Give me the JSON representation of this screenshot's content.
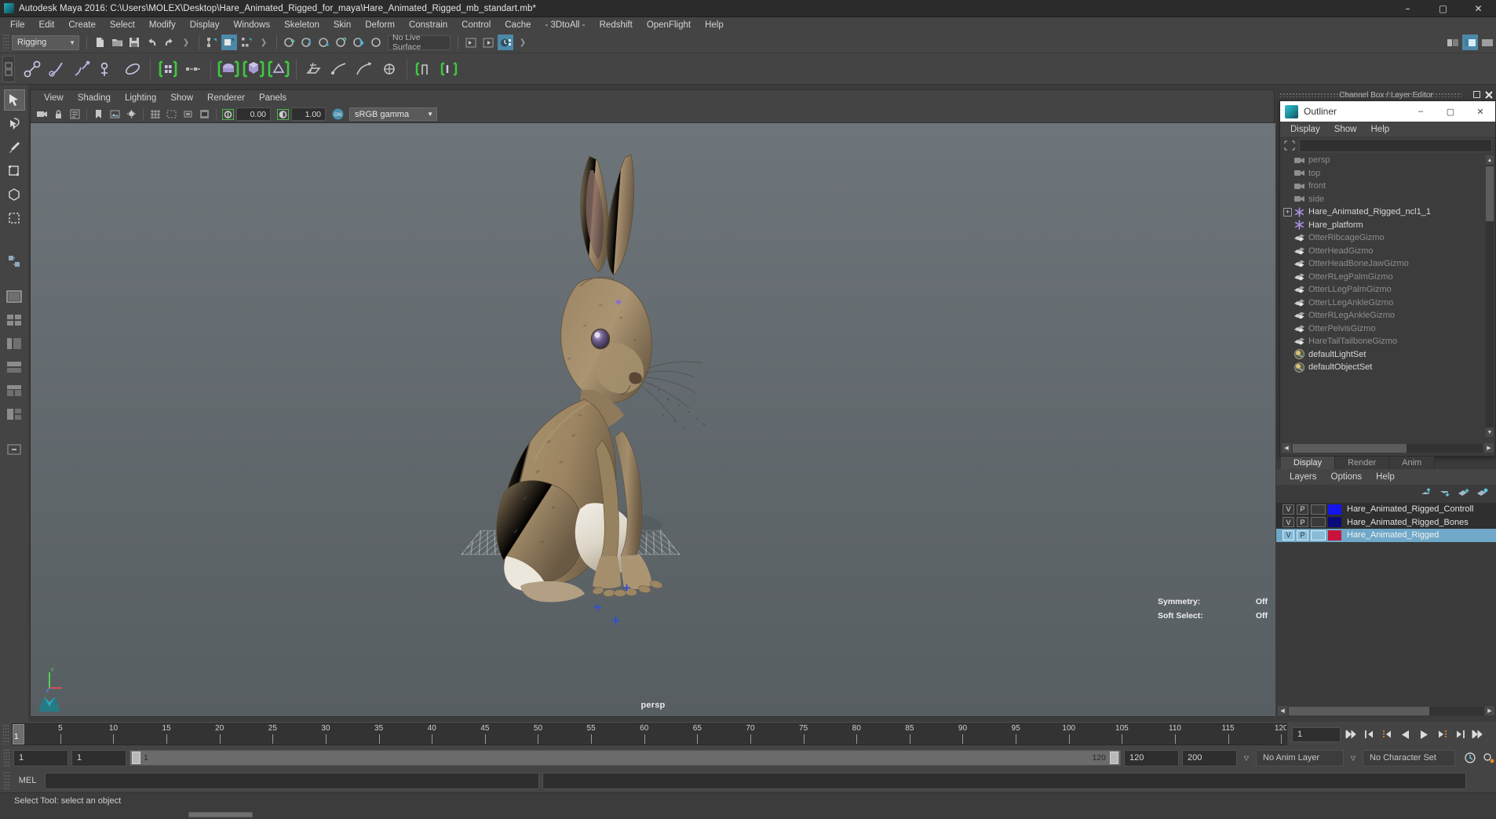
{
  "window": {
    "title": "Autodesk Maya 2016: C:\\Users\\MOLEX\\Desktop\\Hare_Animated_Rigged_for_maya\\Hare_Animated_Rigged_mb_standart.mb*",
    "app_icon": "maya-icon",
    "controls": {
      "minimize": "–",
      "maximize": "▢",
      "close": "✕"
    }
  },
  "menubar": {
    "items": [
      {
        "label": "File"
      },
      {
        "label": "Edit"
      },
      {
        "label": "Create"
      },
      {
        "label": "Select"
      },
      {
        "label": "Modify"
      },
      {
        "label": "Display"
      },
      {
        "label": "Windows"
      },
      {
        "label": "Skeleton"
      },
      {
        "label": "Skin"
      },
      {
        "label": "Deform"
      },
      {
        "label": "Constrain"
      },
      {
        "label": "Control"
      },
      {
        "label": "Cache"
      },
      {
        "label": "- 3DtoAll -"
      },
      {
        "label": "Redshift"
      },
      {
        "label": "OpenFlight"
      },
      {
        "label": "Help"
      }
    ]
  },
  "status_toolbar": {
    "mode_menu": {
      "value": "Rigging"
    },
    "live_surface": {
      "value": "No Live Surface"
    },
    "icons": [
      "new-scene-icon",
      "open-scene-icon",
      "save-scene-icon",
      "undo-icon",
      "redo-icon",
      "select-by-hierarchy-icon",
      "select-by-object-icon",
      "select-by-component-icon",
      "snap-to-grid-icon",
      "snap-to-curve-icon",
      "snap-to-point-icon",
      "snap-to-projected-center-icon",
      "snap-to-view-plane-icon",
      "make-live-icon",
      "show-hide-attribute-editor-icon",
      "show-hide-tool-settings-icon",
      "show-hide-channel-box-icon"
    ]
  },
  "shelf": {
    "tab_icon": "shelf-tab-icon",
    "icons": [
      "joint-tool-icon",
      "ik-handle-tool-icon",
      "ik-spline-handle-icon",
      "insert-joint-tool-icon",
      "skeleton-set-icon",
      "bind-skin-icon",
      "interactive-bind-skin-icon",
      "detach-skin-icon",
      "paint-skin-weights-icon",
      "mirror-skin-weights-icon",
      "lattice-icon",
      "cluster-icon",
      "soft-modifier-icon",
      "wire-tool-icon",
      "nonlinear-bend-icon",
      "wrap-deformer-icon"
    ]
  },
  "toolbox": {
    "tools": [
      {
        "name": "select-tool",
        "selected": true
      },
      {
        "name": "lasso-select-tool",
        "selected": false
      },
      {
        "name": "paint-select-tool",
        "selected": false
      },
      {
        "name": "move-tool",
        "selected": false
      },
      {
        "name": "rotate-tool",
        "selected": false
      },
      {
        "name": "scale-tool",
        "selected": false
      },
      {
        "name": "last-tool-used-icon",
        "selected": false
      },
      {
        "name": "single-perspective-view-layout",
        "selected": false
      },
      {
        "name": "four-view-layout",
        "selected": false
      },
      {
        "name": "persp-outliner-layout",
        "selected": false
      },
      {
        "name": "persp-graph-layout",
        "selected": false
      },
      {
        "name": "hypershade-persp-layout",
        "selected": false
      },
      {
        "name": "persp-render-layout",
        "selected": false
      },
      {
        "name": "more-layouts-icon",
        "selected": false
      }
    ]
  },
  "viewport": {
    "menus": [
      {
        "label": "View"
      },
      {
        "label": "Shading"
      },
      {
        "label": "Lighting"
      },
      {
        "label": "Show"
      },
      {
        "label": "Renderer"
      },
      {
        "label": "Panels"
      }
    ],
    "toolbar": {
      "exposure_value": "0.00",
      "gamma_value": "1.00",
      "color_management": "sRGB gamma",
      "color_management_enabled": "ON",
      "icons": [
        "select-camera-icon",
        "lock-camera-icon",
        "camera-attributes-icon",
        "bookmark-icon",
        "image-plane-icon",
        "two-sided-lighting-icon",
        "shadows-icon",
        "ao-icon",
        "motion-blur-icon",
        "multisample-icon",
        "wireframe-shading-icon",
        "smooth-shade-all-icon",
        "flat-shade-icon",
        "wireframe-on-shaded-icon",
        "textured-icon",
        "use-all-lights-icon",
        "shadows-toggle-icon",
        "screen-space-ao-icon",
        "motion-blur-toggle-icon",
        "multisample-aa-icon",
        "depth-of-field-icon",
        "isolate-select-icon",
        "xray-icon",
        "xray-joints-icon",
        "grid-toggle-icon",
        "exposure-icon",
        "gamma-icon"
      ]
    },
    "label": "persp",
    "hud": [
      {
        "label": "Symmetry:",
        "value": "Off"
      },
      {
        "label": "Soft Select:",
        "value": "Off"
      }
    ],
    "axis_gizmo": {
      "x": "X",
      "y": "Y",
      "z": "Z"
    },
    "scene_object": "hare-3d-model"
  },
  "channel_box_header": {
    "title": "Channel Box / Layer Editor"
  },
  "outliner": {
    "title": "Outliner",
    "icon": "maya-outliner-icon",
    "window_controls": {
      "minimize": "–",
      "maximize": "▢",
      "close": "✕"
    },
    "menus": [
      {
        "label": "Display"
      },
      {
        "label": "Show"
      },
      {
        "label": "Help"
      }
    ],
    "search": {
      "value": "",
      "placeholder": ""
    },
    "search_icon": "filter-icon",
    "items": [
      {
        "label": "persp",
        "icon": "camera-icon",
        "dim": true,
        "expander": false
      },
      {
        "label": "top",
        "icon": "camera-icon",
        "dim": true,
        "expander": false
      },
      {
        "label": "front",
        "icon": "camera-icon",
        "dim": true,
        "expander": false
      },
      {
        "label": "side",
        "icon": "camera-icon",
        "dim": true,
        "expander": false
      },
      {
        "label": "Hare_Animated_Rigged_ncl1_1",
        "icon": "transform-icon",
        "dim": false,
        "expander": true,
        "expander_label": "+"
      },
      {
        "label": "Hare_platform",
        "icon": "transform-icon",
        "dim": false,
        "expander": false
      },
      {
        "label": "OtterRibcageGizmo",
        "icon": "gizmo-icon",
        "dim": true,
        "expander": false
      },
      {
        "label": "OtterHeadGizmo",
        "icon": "gizmo-icon",
        "dim": true,
        "expander": false
      },
      {
        "label": "OtterHeadBoneJawGizmo",
        "icon": "gizmo-icon",
        "dim": true,
        "expander": false
      },
      {
        "label": "OtterRLegPalmGizmo",
        "icon": "gizmo-icon",
        "dim": true,
        "expander": false
      },
      {
        "label": "OtterLLegPalmGizmo",
        "icon": "gizmo-icon",
        "dim": true,
        "expander": false
      },
      {
        "label": "OtterLLegAnkleGizmo",
        "icon": "gizmo-icon",
        "dim": true,
        "expander": false
      },
      {
        "label": "OtterRLegAnkleGizmo",
        "icon": "gizmo-icon",
        "dim": true,
        "expander": false
      },
      {
        "label": "OtterPelvisGizmo",
        "icon": "gizmo-icon",
        "dim": true,
        "expander": false
      },
      {
        "label": "HareTailTailboneGizmo",
        "icon": "gizmo-icon",
        "dim": true,
        "expander": false
      },
      {
        "label": "defaultLightSet",
        "icon": "set-icon",
        "dim": false,
        "expander": false
      },
      {
        "label": "defaultObjectSet",
        "icon": "set-icon",
        "dim": false,
        "expander": false
      }
    ]
  },
  "layer_editor": {
    "tabs": [
      {
        "label": "Display",
        "active": true
      },
      {
        "label": "Render",
        "active": false
      },
      {
        "label": "Anim",
        "active": false
      }
    ],
    "menus": [
      {
        "label": "Layers"
      },
      {
        "label": "Options"
      },
      {
        "label": "Help"
      }
    ],
    "toolbar_icons": [
      "move-layer-up-icon",
      "move-layer-down-icon",
      "new-layer-icon",
      "new-layer-from-selected-icon"
    ],
    "layers": [
      {
        "visibility": "V",
        "playback": "P",
        "shading": "",
        "color": "#1414f0",
        "name": "Hare_Animated_Rigged_Controll",
        "selected": false
      },
      {
        "visibility": "V",
        "playback": "P",
        "shading": "",
        "color": "#0a0a7a",
        "name": "Hare_Animated_Rigged_Bones",
        "selected": false
      },
      {
        "visibility": "V",
        "playback": "P",
        "shading": "",
        "color": "#c8143c",
        "name": "Hare_Animated_Rigged",
        "selected": true
      }
    ]
  },
  "time_slider": {
    "current_frame": "1",
    "start": 1,
    "end": 120,
    "ticks": [
      5,
      10,
      15,
      20,
      25,
      30,
      35,
      40,
      45,
      50,
      55,
      60,
      65,
      70,
      75,
      80,
      85,
      90,
      95,
      100,
      105,
      110,
      115,
      120
    ],
    "frame_field": "1",
    "playback_buttons": [
      "go-to-start-icon",
      "step-back-keyframe-icon",
      "step-back-frame-icon",
      "play-backwards-icon",
      "play-forwards-icon",
      "step-forward-frame-icon",
      "step-forward-keyframe-icon",
      "go-to-end-icon"
    ]
  },
  "range_slider": {
    "anim_start": "1",
    "playback_start": "1",
    "range_left_label": "1",
    "range_right_label": "120",
    "playback_end": "120",
    "anim_end": "200",
    "anim_layer": "No Anim Layer",
    "character_set": "No Character Set",
    "icons": [
      "auto-keyframe-icon",
      "animation-preferences-icon"
    ]
  },
  "command_line": {
    "label": "MEL",
    "input_value": "",
    "output_value": ""
  },
  "help_line": {
    "text": "Select Tool: select an object"
  },
  "colors": {
    "accent_blue": "#4d88a8",
    "selection_highlight": "#6fa8c8",
    "panel_bg": "#444444",
    "viewport_bg": "#656c71"
  }
}
